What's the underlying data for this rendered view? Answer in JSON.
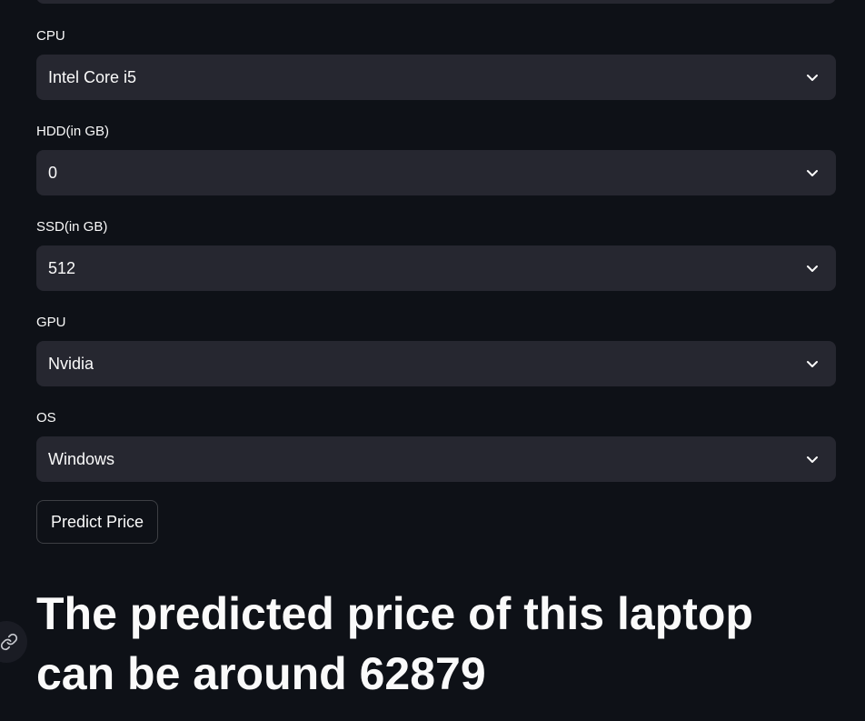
{
  "fields": [
    {
      "label": "CPU",
      "value": "Intel Core i5"
    },
    {
      "label": "HDD(in GB)",
      "value": "0"
    },
    {
      "label": "SSD(in GB)",
      "value": "512"
    },
    {
      "label": "GPU",
      "value": "Nvidia"
    },
    {
      "label": "OS",
      "value": "Windows"
    }
  ],
  "predict_button": {
    "label": "Predict Price"
  },
  "result": {
    "text": "The predicted price of this laptop can be around 62879"
  },
  "icons": {
    "select_chevron": "chevron-down-icon",
    "heading_anchor": "link-icon"
  },
  "colors": {
    "background": "#0e1117",
    "select_background": "#262730",
    "text": "#fafafa"
  }
}
